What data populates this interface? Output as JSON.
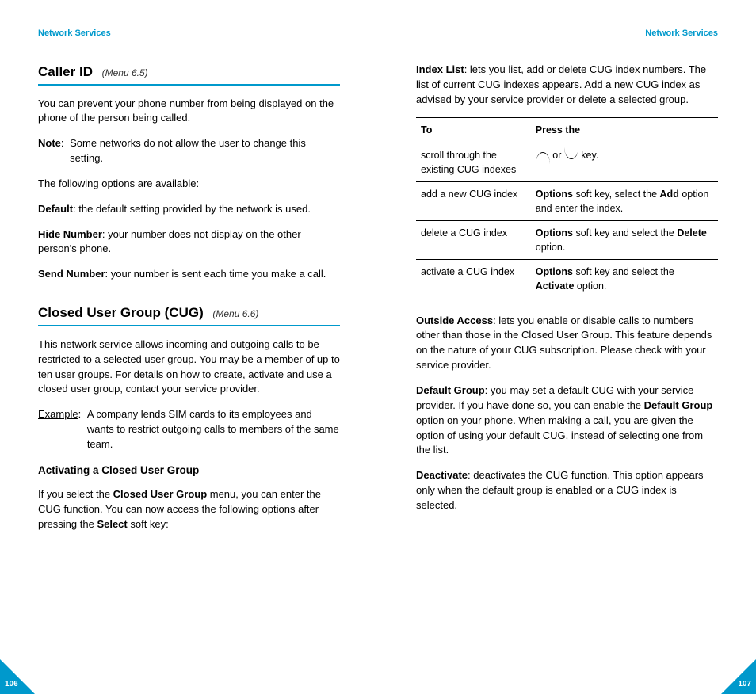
{
  "left": {
    "header": "Network Services",
    "section1": {
      "title": "Caller ID",
      "menu": "(Menu 6.5)",
      "intro": "You can prevent your phone number from being displayed on the phone of the person being called.",
      "note_label": "Note",
      "note_text": "Some networks do not allow the user to change this setting.",
      "options_intro": "The following options are available:",
      "opt_default_label": "Default",
      "opt_default_text": ": the default setting provided by the network is used.",
      "opt_hide_label": "Hide Number",
      "opt_hide_text": ": your number does not display on the other person's phone.",
      "opt_send_label": "Send Number",
      "opt_send_text": ": your number is sent each time you make a call."
    },
    "section2": {
      "title": "Closed User Group (CUG)",
      "menu": "(Menu 6.6)",
      "intro": "This network service allows incoming and outgoing calls to be restricted to a selected user group. You may be a member of up to ten user groups. For details on how to create, activate and use a closed user group, contact your service provider.",
      "example_label": "Example",
      "example_text": "A company lends SIM cards to its employees and wants to restrict outgoing calls to members of the same team.",
      "sub_title": "Activating a Closed User Group",
      "sub_p1_a": "If you select the ",
      "sub_p1_b": "Closed User Group",
      "sub_p1_c": " menu, you can enter the CUG function. You can now access the following options after pressing the ",
      "sub_p1_d": "Select",
      "sub_p1_e": " soft key:"
    },
    "page_number": "106"
  },
  "right": {
    "header": "Network Services",
    "p1_a": "Index List",
    "p1_b": ": lets you list, add or delete CUG index numbers. The list of current CUG indexes appears. Add a new CUG index as advised by your service provider or delete a selected group.",
    "table": {
      "h1": "To",
      "h2": "Press the",
      "rows": [
        {
          "to": "scroll through the existing CUG indexes",
          "key_prefix": "",
          "key_b1": "",
          "key_mid": " or ",
          "key_b2": "",
          "key_suffix": " key.",
          "icons": true
        },
        {
          "to": "add a new CUG index",
          "key_prefix": "",
          "key_b1": "Options",
          "key_mid": " soft key, select the ",
          "key_b2": "Add",
          "key_suffix": " option and enter the index."
        },
        {
          "to": "delete a CUG index",
          "key_prefix": "",
          "key_b1": "Options",
          "key_mid": " soft key and select the ",
          "key_b2": "Delete",
          "key_suffix": " option."
        },
        {
          "to": "activate a CUG index",
          "key_prefix": "",
          "key_b1": "Options",
          "key_mid": " soft key and select the ",
          "key_b2": "Activate",
          "key_suffix": " option."
        }
      ]
    },
    "p2_a": "Outside Access",
    "p2_b": ": lets you enable or disable calls to numbers other than those in the Closed User Group. This feature depends on the nature of your CUG subscription. Please check with your service provider.",
    "p3_a": "Default Group",
    "p3_b": ": you may set a default CUG with your service provider. If you have done so, you can enable the ",
    "p3_c": "Default Group",
    "p3_d": " option on your phone. When making a call, you are given the option of using your default CUG, instead of selecting one from the list.",
    "p4_a": "Deactivate",
    "p4_b": ": deactivates the CUG function. This option appears only when the default group is enabled or a CUG index is selected.",
    "page_number": "107"
  }
}
